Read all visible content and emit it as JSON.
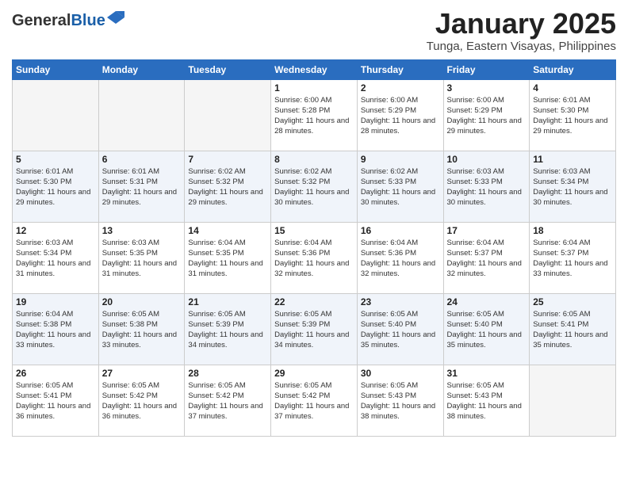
{
  "header": {
    "logo_general": "General",
    "logo_blue": "Blue",
    "month": "January 2025",
    "location": "Tunga, Eastern Visayas, Philippines"
  },
  "days_of_week": [
    "Sunday",
    "Monday",
    "Tuesday",
    "Wednesday",
    "Thursday",
    "Friday",
    "Saturday"
  ],
  "weeks": [
    [
      {
        "day": "",
        "empty": true
      },
      {
        "day": "",
        "empty": true
      },
      {
        "day": "",
        "empty": true
      },
      {
        "day": "1",
        "sunrise": "Sunrise: 6:00 AM",
        "sunset": "Sunset: 5:28 PM",
        "daylight": "Daylight: 11 hours and 28 minutes."
      },
      {
        "day": "2",
        "sunrise": "Sunrise: 6:00 AM",
        "sunset": "Sunset: 5:29 PM",
        "daylight": "Daylight: 11 hours and 28 minutes."
      },
      {
        "day": "3",
        "sunrise": "Sunrise: 6:00 AM",
        "sunset": "Sunset: 5:29 PM",
        "daylight": "Daylight: 11 hours and 29 minutes."
      },
      {
        "day": "4",
        "sunrise": "Sunrise: 6:01 AM",
        "sunset": "Sunset: 5:30 PM",
        "daylight": "Daylight: 11 hours and 29 minutes."
      }
    ],
    [
      {
        "day": "5",
        "sunrise": "Sunrise: 6:01 AM",
        "sunset": "Sunset: 5:30 PM",
        "daylight": "Daylight: 11 hours and 29 minutes."
      },
      {
        "day": "6",
        "sunrise": "Sunrise: 6:01 AM",
        "sunset": "Sunset: 5:31 PM",
        "daylight": "Daylight: 11 hours and 29 minutes."
      },
      {
        "day": "7",
        "sunrise": "Sunrise: 6:02 AM",
        "sunset": "Sunset: 5:32 PM",
        "daylight": "Daylight: 11 hours and 29 minutes."
      },
      {
        "day": "8",
        "sunrise": "Sunrise: 6:02 AM",
        "sunset": "Sunset: 5:32 PM",
        "daylight": "Daylight: 11 hours and 30 minutes."
      },
      {
        "day": "9",
        "sunrise": "Sunrise: 6:02 AM",
        "sunset": "Sunset: 5:33 PM",
        "daylight": "Daylight: 11 hours and 30 minutes."
      },
      {
        "day": "10",
        "sunrise": "Sunrise: 6:03 AM",
        "sunset": "Sunset: 5:33 PM",
        "daylight": "Daylight: 11 hours and 30 minutes."
      },
      {
        "day": "11",
        "sunrise": "Sunrise: 6:03 AM",
        "sunset": "Sunset: 5:34 PM",
        "daylight": "Daylight: 11 hours and 30 minutes."
      }
    ],
    [
      {
        "day": "12",
        "sunrise": "Sunrise: 6:03 AM",
        "sunset": "Sunset: 5:34 PM",
        "daylight": "Daylight: 11 hours and 31 minutes."
      },
      {
        "day": "13",
        "sunrise": "Sunrise: 6:03 AM",
        "sunset": "Sunset: 5:35 PM",
        "daylight": "Daylight: 11 hours and 31 minutes."
      },
      {
        "day": "14",
        "sunrise": "Sunrise: 6:04 AM",
        "sunset": "Sunset: 5:35 PM",
        "daylight": "Daylight: 11 hours and 31 minutes."
      },
      {
        "day": "15",
        "sunrise": "Sunrise: 6:04 AM",
        "sunset": "Sunset: 5:36 PM",
        "daylight": "Daylight: 11 hours and 32 minutes."
      },
      {
        "day": "16",
        "sunrise": "Sunrise: 6:04 AM",
        "sunset": "Sunset: 5:36 PM",
        "daylight": "Daylight: 11 hours and 32 minutes."
      },
      {
        "day": "17",
        "sunrise": "Sunrise: 6:04 AM",
        "sunset": "Sunset: 5:37 PM",
        "daylight": "Daylight: 11 hours and 32 minutes."
      },
      {
        "day": "18",
        "sunrise": "Sunrise: 6:04 AM",
        "sunset": "Sunset: 5:37 PM",
        "daylight": "Daylight: 11 hours and 33 minutes."
      }
    ],
    [
      {
        "day": "19",
        "sunrise": "Sunrise: 6:04 AM",
        "sunset": "Sunset: 5:38 PM",
        "daylight": "Daylight: 11 hours and 33 minutes."
      },
      {
        "day": "20",
        "sunrise": "Sunrise: 6:05 AM",
        "sunset": "Sunset: 5:38 PM",
        "daylight": "Daylight: 11 hours and 33 minutes."
      },
      {
        "day": "21",
        "sunrise": "Sunrise: 6:05 AM",
        "sunset": "Sunset: 5:39 PM",
        "daylight": "Daylight: 11 hours and 34 minutes."
      },
      {
        "day": "22",
        "sunrise": "Sunrise: 6:05 AM",
        "sunset": "Sunset: 5:39 PM",
        "daylight": "Daylight: 11 hours and 34 minutes."
      },
      {
        "day": "23",
        "sunrise": "Sunrise: 6:05 AM",
        "sunset": "Sunset: 5:40 PM",
        "daylight": "Daylight: 11 hours and 35 minutes."
      },
      {
        "day": "24",
        "sunrise": "Sunrise: 6:05 AM",
        "sunset": "Sunset: 5:40 PM",
        "daylight": "Daylight: 11 hours and 35 minutes."
      },
      {
        "day": "25",
        "sunrise": "Sunrise: 6:05 AM",
        "sunset": "Sunset: 5:41 PM",
        "daylight": "Daylight: 11 hours and 35 minutes."
      }
    ],
    [
      {
        "day": "26",
        "sunrise": "Sunrise: 6:05 AM",
        "sunset": "Sunset: 5:41 PM",
        "daylight": "Daylight: 11 hours and 36 minutes."
      },
      {
        "day": "27",
        "sunrise": "Sunrise: 6:05 AM",
        "sunset": "Sunset: 5:42 PM",
        "daylight": "Daylight: 11 hours and 36 minutes."
      },
      {
        "day": "28",
        "sunrise": "Sunrise: 6:05 AM",
        "sunset": "Sunset: 5:42 PM",
        "daylight": "Daylight: 11 hours and 37 minutes."
      },
      {
        "day": "29",
        "sunrise": "Sunrise: 6:05 AM",
        "sunset": "Sunset: 5:42 PM",
        "daylight": "Daylight: 11 hours and 37 minutes."
      },
      {
        "day": "30",
        "sunrise": "Sunrise: 6:05 AM",
        "sunset": "Sunset: 5:43 PM",
        "daylight": "Daylight: 11 hours and 38 minutes."
      },
      {
        "day": "31",
        "sunrise": "Sunrise: 6:05 AM",
        "sunset": "Sunset: 5:43 PM",
        "daylight": "Daylight: 11 hours and 38 minutes."
      },
      {
        "day": "",
        "empty": true
      }
    ]
  ]
}
